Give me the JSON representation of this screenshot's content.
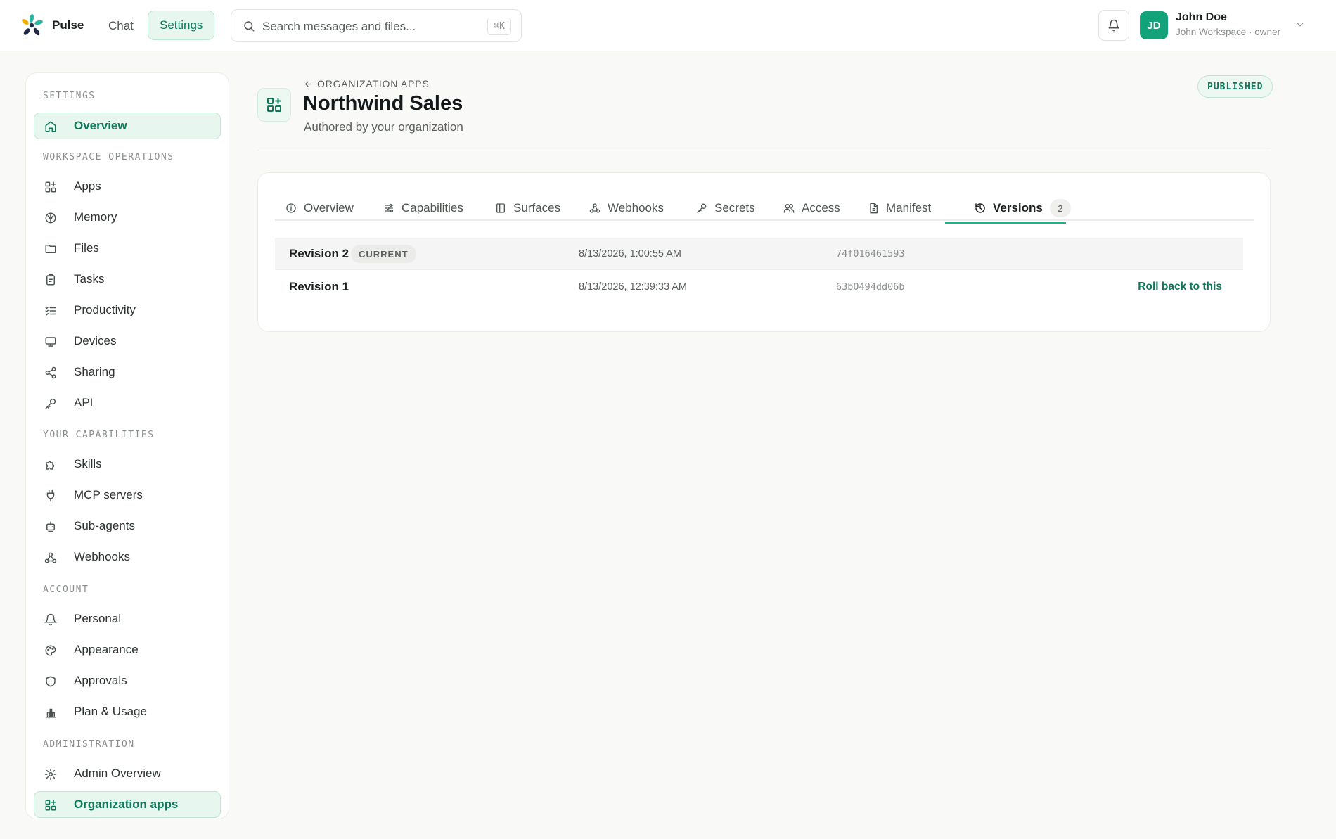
{
  "app": {
    "name": "Pulse"
  },
  "topnav": {
    "chat_label": "Chat",
    "settings_label": "Settings"
  },
  "search": {
    "placeholder": "Search messages and files...",
    "shortcut": "⌘K"
  },
  "user": {
    "initials": "JD",
    "name": "John Doe",
    "subtitle": "John Workspace · owner"
  },
  "sidebar": {
    "sections": [
      {
        "title": "SETTINGS",
        "items": [
          {
            "label": "Overview",
            "icon": "home-icon",
            "active": true
          }
        ]
      },
      {
        "title": "WORKSPACE OPERATIONS",
        "items": [
          {
            "label": "Apps",
            "icon": "apps-icon"
          },
          {
            "label": "Memory",
            "icon": "brain-icon"
          },
          {
            "label": "Files",
            "icon": "folder-icon"
          },
          {
            "label": "Tasks",
            "icon": "clipboard-icon"
          },
          {
            "label": "Productivity",
            "icon": "list-checks-icon"
          },
          {
            "label": "Devices",
            "icon": "monitor-icon"
          },
          {
            "label": "Sharing",
            "icon": "share-icon"
          },
          {
            "label": "API",
            "icon": "key-icon"
          }
        ]
      },
      {
        "title": "YOUR CAPABILITIES",
        "items": [
          {
            "label": "Skills",
            "icon": "puzzle-icon"
          },
          {
            "label": "MCP servers",
            "icon": "plug-icon"
          },
          {
            "label": "Sub-agents",
            "icon": "bot-icon"
          },
          {
            "label": "Webhooks",
            "icon": "webhook-icon"
          }
        ]
      },
      {
        "title": "ACCOUNT",
        "items": [
          {
            "label": "Personal",
            "icon": "bell-icon"
          },
          {
            "label": "Appearance",
            "icon": "palette-icon"
          },
          {
            "label": "Approvals",
            "icon": "shield-icon"
          },
          {
            "label": "Plan & Usage",
            "icon": "bar-chart-icon"
          }
        ]
      },
      {
        "title": "ADMINISTRATION",
        "items": [
          {
            "label": "Admin Overview",
            "icon": "gear-icon"
          },
          {
            "label": "Organization apps",
            "icon": "apps-icon",
            "active": true
          }
        ]
      }
    ]
  },
  "page": {
    "breadcrumb": "ORGANIZATION APPS",
    "title": "Northwind Sales",
    "subtitle": "Authored by your organization",
    "status": "PUBLISHED"
  },
  "tabs": [
    {
      "label": "Overview",
      "icon": "info-icon"
    },
    {
      "label": "Capabilities",
      "icon": "sliders-icon"
    },
    {
      "label": "Surfaces",
      "icon": "panel-icon"
    },
    {
      "label": "Webhooks",
      "icon": "webhook-icon"
    },
    {
      "label": "Secrets",
      "icon": "key-icon"
    },
    {
      "label": "Access",
      "icon": "users-icon"
    },
    {
      "label": "Manifest",
      "icon": "file-icon"
    },
    {
      "label": "Versions",
      "icon": "history-icon",
      "count": "2",
      "active": true
    }
  ],
  "revisions": [
    {
      "name": "Revision 2",
      "tag": "CURRENT",
      "date": "8/13/2026, 1:00:55 AM",
      "hash": "74f016461593"
    },
    {
      "name": "Revision 1",
      "date": "8/13/2026, 12:39:33 AM",
      "hash": "63b0494dd06b",
      "action": "Roll back to this"
    }
  ],
  "colors": {
    "accent": "#0e7a5a",
    "accent_bg": "#e8f6f0",
    "avatar": "#13a37a",
    "tab_underline": "#19b389"
  }
}
